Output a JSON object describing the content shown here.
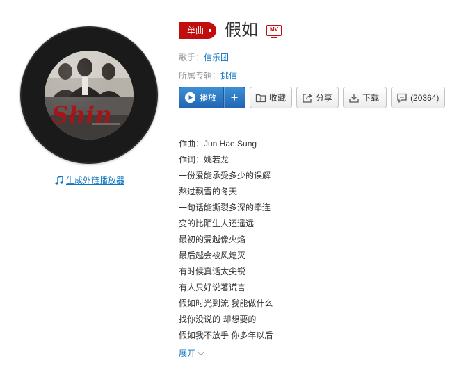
{
  "cover": {
    "art_text": "Shin"
  },
  "generate_link": {
    "label": "生成外链播放器",
    "icon": "music-note-icon"
  },
  "header": {
    "tag": "单曲",
    "title": "假如",
    "mv_badge": "MV"
  },
  "meta": {
    "singer_label": "歌手：",
    "singer": "信乐团",
    "album_label": "所属专辑：",
    "album": "挑信"
  },
  "buttons": {
    "play": "播放",
    "add": "+",
    "collect": "收藏",
    "share": "分享",
    "download": "下载",
    "comment": "(20364)"
  },
  "lyrics": [
    "作曲：Jun Hae Sung",
    "作词：姚若龙",
    "一份爱能承受多少的误解",
    "熬过飘雪的冬天",
    "一句话能撕裂多深的牵连",
    "变的比陌生人还遥远",
    "最初的爱越像火焰",
    "最后越会被风熄灭",
    "有时候真话太尖锐",
    "有人只好说著谎言",
    "假如时光到流 我能做什么",
    "找你没说的 却想要的",
    "假如我不放手 你多年以后"
  ],
  "expand": {
    "label": "展开"
  },
  "colors": {
    "accent": "#c10d0c",
    "link": "#0c73c2",
    "play": "#2b76c4"
  }
}
